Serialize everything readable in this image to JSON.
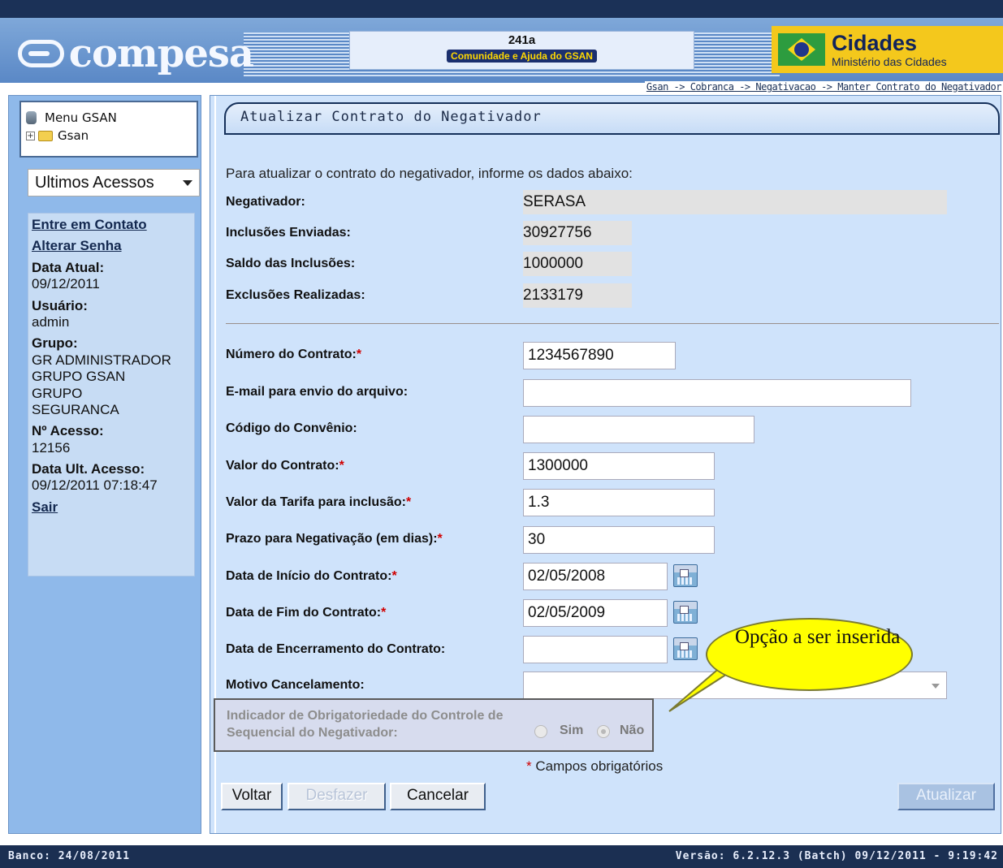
{
  "header": {
    "logo_text": "compesa",
    "app_code": "241a",
    "app_tagline": "Comunidade e Ajuda do GSAN",
    "cidades_title": "Cidades",
    "cidades_subtitle": "Ministério das Cidades",
    "breadcrumb": "Gsan -> Cobranca -> Negativacao -> Manter Contrato do Negativador"
  },
  "sidebar": {
    "menu_title": "Menu GSAN",
    "menu_root": "Gsan",
    "recent_select": "Ultimos Acessos",
    "links": [
      "Entre em Contato",
      "Alterar Senha"
    ],
    "data_atual_label": "Data Atual:",
    "data_atual": "09/12/2011",
    "usuario_label": "Usuário:",
    "usuario": "admin",
    "grupo_label": "Grupo:",
    "grupos": [
      "GR ADMINISTRADOR",
      "GRUPO GSAN",
      "GRUPO",
      "SEGURANCA"
    ],
    "acesso_label": "Nº Acesso:",
    "acesso": "12156",
    "ult_acesso_label": "Data Ult. Acesso:",
    "ult_acesso": "09/12/2011 07:18:47",
    "sair": "Sair"
  },
  "form": {
    "title": "Atualizar Contrato do Negativador",
    "intro": "Para atualizar o contrato do negativador, informe os dados abaixo:",
    "negativador_label": "Negativador:",
    "negativador": "SERASA",
    "inclusoes_label": "Inclusões Enviadas:",
    "inclusoes": "30927756",
    "saldo_label": "Saldo das Inclusões:",
    "saldo": "1000000",
    "exclusoes_label": "Exclusões Realizadas:",
    "exclusoes": "2133179",
    "numero_contrato_label": "Número do Contrato:",
    "numero_contrato": "1234567890",
    "email_label": "E-mail para envio do arquivo:",
    "email": "",
    "convenio_label": "Código do Convênio:",
    "convenio": "",
    "valor_contrato_label": "Valor do Contrato:",
    "valor_contrato": "1300000",
    "tarifa_label": "Valor da Tarifa para inclusão:",
    "tarifa": "1.3",
    "prazo_label": "Prazo para Negativação (em dias):",
    "prazo": "30",
    "data_inicio_label": "Data de Início do Contrato:",
    "data_inicio": "02/05/2008",
    "data_fim_label": "Data de Fim do Contrato:",
    "data_fim": "02/05/2009",
    "data_encerramento_label": "Data de Encerramento do Contrato:",
    "data_encerramento": "",
    "motivo_label": "Motivo Cancelamento:",
    "motivo": "",
    "indicador_label": "Indicador de Obrigatoriedade do Controle de Sequencial do Negativador:",
    "radio_sim": "Sim",
    "radio_nao": "Não",
    "required_star": "*",
    "required_note": "Campos obrigatórios",
    "balloon_text": "Opção a ser inserida"
  },
  "buttons": {
    "voltar": "Voltar",
    "desfazer": "Desfazer",
    "cancelar": "Cancelar",
    "atualizar": "Atualizar"
  },
  "footer": {
    "banco": "Banco: 24/08/2011",
    "versao": "Versão: 6.2.12.3 (Batch) 09/12/2011 - 9:19:42"
  }
}
